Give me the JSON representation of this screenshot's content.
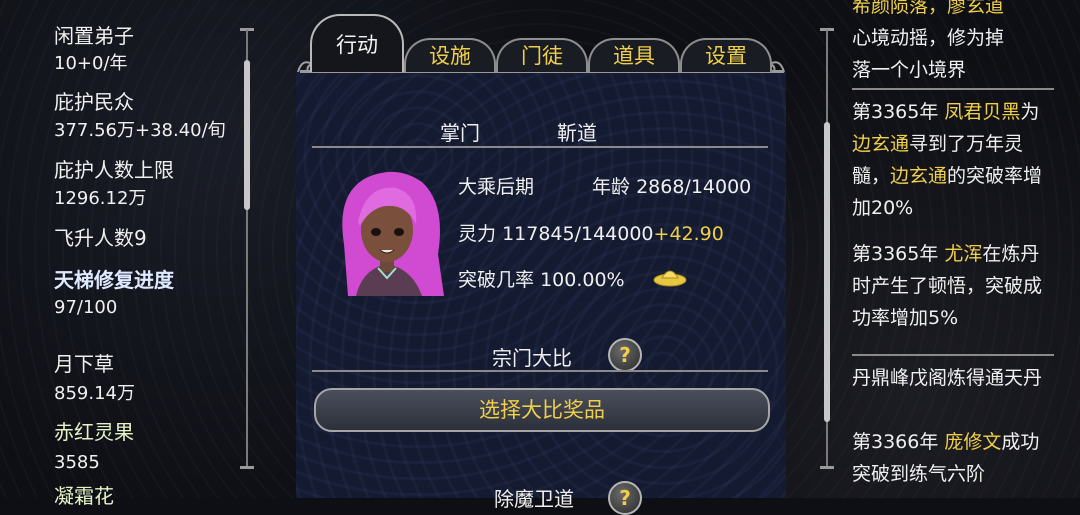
{
  "left_panel": {
    "idle_disciples": {
      "label": "闲置弟子",
      "base": "10",
      "rate": "+0/年"
    },
    "protected_people": {
      "label": "庇护民众",
      "base": "377.56万",
      "rate": "+38.40/旬"
    },
    "protect_limit": {
      "label": "庇护人数上限",
      "value": "1296.12万"
    },
    "ascended": {
      "label": "飞升人数9"
    },
    "ladder_repair": {
      "label": "天梯修复进度",
      "value": "97/100"
    },
    "item1": {
      "label": "月下草",
      "value": "859.14万"
    },
    "item2": {
      "label": "赤红灵果",
      "value": "3585"
    },
    "item3_partial": {
      "label": "凝霜花"
    }
  },
  "tabs": [
    {
      "label": "行动",
      "active": true
    },
    {
      "label": "设施",
      "active": false
    },
    {
      "label": "门徒",
      "active": false
    },
    {
      "label": "道具",
      "active": false
    },
    {
      "label": "设置",
      "active": false
    }
  ],
  "leader": {
    "title_label": "掌门",
    "name": "靳道",
    "realm": "大乘后期",
    "age_label": "年龄",
    "age_value": "2868/14000",
    "spirit_label": "灵力",
    "spirit_value": "117845/144000",
    "spirit_rate": "+42.90",
    "breakthrough_label": "突破几率",
    "breakthrough_value": "100.00%"
  },
  "tournament": {
    "title": "宗门大比",
    "help_symbol": "?",
    "button_label": "选择大比奖品",
    "next_title_partial": "除魔卫道"
  },
  "event_log": {
    "entry0_partial": {
      "top_a": "希颜陨落，",
      "top_b": "廖玄道",
      "line2": "心境动摇，修为掉",
      "line3": "落一个小境界"
    },
    "entry1": {
      "year": "第3365年",
      "name1": "凤君贝黑",
      "t1": "为",
      "name2": "边玄通",
      "t2": "寻到了万年灵髓，",
      "name3": "边玄通",
      "t3": "的突破率增加20%"
    },
    "entry2": {
      "year": "第3365年",
      "name": "尤浑",
      "text": "在炼丹时产生了顿悟，突破成功率增加5%"
    },
    "entry3": {
      "text": "丹鼎峰戊阁炼得通天丹"
    },
    "entry4": {
      "year": "第3366年",
      "name": "庞修文",
      "text": "成功突破到练气六阶"
    }
  },
  "colors": {
    "accent_yellow": "#f0d04a",
    "panel_bg": "#141a30"
  }
}
